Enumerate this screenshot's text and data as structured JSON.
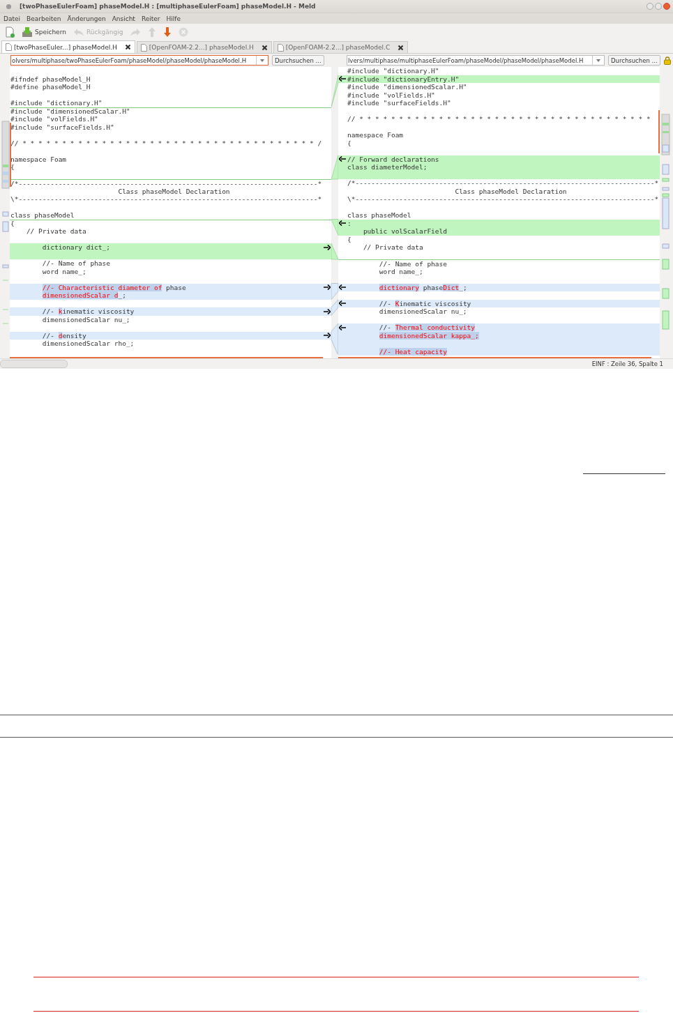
{
  "window": {
    "title": "[twoPhaseEulerFoam] phaseModel.H : [multiphaseEulerFoam] phaseModel.H - Meld"
  },
  "menu": [
    "Datei",
    "Bearbeiten",
    "Änderungen",
    "Ansicht",
    "Reiter",
    "Hilfe"
  ],
  "toolbar": [
    {
      "kind": "new",
      "disabled": false
    },
    {
      "kind": "save",
      "label": "Speichern",
      "disabled": false
    },
    {
      "kind": "undo",
      "label": "Rückgängig",
      "disabled": true
    },
    {
      "kind": "redo",
      "disabled": true
    },
    {
      "kind": "up",
      "disabled": true
    },
    {
      "kind": "down",
      "disabled": false
    },
    {
      "kind": "stop",
      "disabled": true
    }
  ],
  "tabs": [
    {
      "label": "[twoPhaseEuler...] phaseModel.H",
      "selected": true
    },
    {
      "label": "[OpenFOAM-2.2...] phaseModel.H",
      "selected": false
    },
    {
      "label": "[OpenFOAM-2.2...] phaseModel.C",
      "selected": false
    }
  ],
  "panes": [
    {
      "path": "olvers/multiphase/twoPhaseEulerFoam/phaseModel/phaseModel/phaseModel.H",
      "focused": true,
      "browse": "Durchsuchen ...",
      "lines": [
        {
          "kind": "plain"
        },
        {
          "kind": "plain",
          "text": "#ifndef phaseModel_H"
        },
        {
          "kind": "plain",
          "text": "#define phaseModel_H"
        },
        {
          "kind": "plain"
        },
        {
          "kind": "plain",
          "text": "#include \"dictionary.H\""
        },
        {
          "kind": "plain",
          "text": "#include \"dimensionedScalar.H\"",
          "mark": true
        },
        {
          "kind": "plain",
          "text": "#include \"volFields.H\""
        },
        {
          "kind": "plain",
          "text": "#include \"surfaceFields.H\""
        },
        {
          "kind": "plain"
        },
        {
          "kind": "plain",
          "text": "// * * * * * * * * * * * * * * * * * * * * * * * * * * * * * * * * * * * * * /"
        },
        {
          "kind": "plain"
        },
        {
          "kind": "plain",
          "text": "namespace Foam"
        },
        {
          "kind": "plain",
          "text": "{"
        },
        {
          "kind": "plain"
        },
        {
          "kind": "plain",
          "text": "/*---------------------------------------------------------------------------*",
          "mark": true
        },
        {
          "kind": "plain",
          "text": "                           Class phaseModel Declaration"
        },
        {
          "kind": "plain",
          "text": "\\*---------------------------------------------------------------------------*"
        },
        {
          "kind": "plain"
        },
        {
          "kind": "plain",
          "text": "class phaseModel"
        },
        {
          "kind": "plain",
          "text": "{",
          "mark": true
        },
        {
          "kind": "plain",
          "text": "    // Private data"
        },
        {
          "kind": "plain"
        },
        {
          "kind": "insert",
          "text": "        dictionary dict_;",
          "arrow": true
        },
        {
          "kind": "insert"
        },
        {
          "kind": "plain",
          "text": "        //- Name of phase"
        },
        {
          "kind": "plain",
          "text": "        word name_;"
        },
        {
          "kind": "plain"
        },
        {
          "kind": "change",
          "arrow": true,
          "segments": [
            {
              "t": "        //- Characteristic diameter of",
              "kind": "changed"
            },
            {
              "t": " phase",
              "kind": "plain"
            }
          ]
        },
        {
          "kind": "change",
          "segments": [
            {
              "t": "        dimensionedScalar d",
              "kind": "changed"
            },
            {
              "t": "_;",
              "kind": "plain"
            }
          ]
        },
        {
          "kind": "plain"
        },
        {
          "kind": "change",
          "arrow": true,
          "segments": [
            {
              "t": "        //- ",
              "kind": "plain"
            },
            {
              "t": "k",
              "kind": "changed"
            },
            {
              "t": "inematic viscosity",
              "kind": "plain"
            }
          ]
        },
        {
          "kind": "plain",
          "text": "        dimensionedScalar nu_;"
        },
        {
          "kind": "plain"
        },
        {
          "kind": "change",
          "arrow": true,
          "segments": [
            {
              "t": "        //- ",
              "kind": "plain"
            },
            {
              "t": "d",
              "kind": "changed"
            },
            {
              "t": "ensity",
              "kind": "plain"
            }
          ]
        },
        {
          "kind": "plain",
          "text": "        dimensionedScalar rho_;"
        }
      ]
    },
    {
      "path": "lvers/multiphase/multiphaseEulerFoam/phaseModel/phaseModel/phaseModel.H",
      "focused": false,
      "browse": "Durchsuchen ...",
      "lines": [
        {
          "kind": "plain",
          "text": "#include \"dictionary.H\""
        },
        {
          "kind": "insert",
          "text": "#include \"dictionaryEntry.H\"",
          "arrow": true
        },
        {
          "kind": "plain",
          "text": "#include \"dimensionedScalar.H\""
        },
        {
          "kind": "plain",
          "text": "#include \"volFields.H\""
        },
        {
          "kind": "plain",
          "text": "#include \"surfaceFields.H\""
        },
        {
          "kind": "plain"
        },
        {
          "kind": "plain",
          "text": "// * * * * * * * * * * * * * * * * * * * * * * * * * * * * * * * * * * * * *"
        },
        {
          "kind": "plain"
        },
        {
          "kind": "plain",
          "text": "namespace Foam"
        },
        {
          "kind": "plain",
          "text": "{"
        },
        {
          "kind": "plain"
        },
        {
          "kind": "insert",
          "text": "// Forward declarations",
          "arrow": true
        },
        {
          "kind": "insert",
          "text": "class diameterModel;"
        },
        {
          "kind": "insert"
        },
        {
          "kind": "plain",
          "text": "/*---------------------------------------------------------------------------*"
        },
        {
          "kind": "plain",
          "text": "                           Class phaseModel Declaration"
        },
        {
          "kind": "plain",
          "text": "\\*---------------------------------------------------------------------------*"
        },
        {
          "kind": "plain"
        },
        {
          "kind": "plain",
          "text": "class phaseModel"
        },
        {
          "kind": "insert",
          "text": ":",
          "arrow": true
        },
        {
          "kind": "insert",
          "text": "    public volScalarField"
        },
        {
          "kind": "plain",
          "text": "{"
        },
        {
          "kind": "plain",
          "text": "    // Private data"
        },
        {
          "kind": "plain"
        },
        {
          "kind": "plain",
          "text": "        //- Name of phase",
          "mark": true
        },
        {
          "kind": "plain",
          "text": "        word name_;"
        },
        {
          "kind": "plain"
        },
        {
          "kind": "change",
          "arrow": true,
          "segments": [
            {
              "t": "        dictionary",
              "kind": "changed"
            },
            {
              "t": " phase",
              "kind": "plain"
            },
            {
              "t": "Dict",
              "kind": "changed"
            },
            {
              "t": "_;",
              "kind": "plain"
            }
          ]
        },
        {
          "kind": "plain"
        },
        {
          "kind": "change",
          "arrow": true,
          "segments": [
            {
              "t": "        //- ",
              "kind": "plain"
            },
            {
              "t": "K",
              "kind": "changed"
            },
            {
              "t": "inematic viscosity",
              "kind": "plain"
            }
          ]
        },
        {
          "kind": "plain",
          "text": "        dimensionedScalar nu_;"
        },
        {
          "kind": "plain"
        },
        {
          "kind": "change",
          "arrow": true,
          "segments": [
            {
              "t": "        //- ",
              "kind": "plain"
            },
            {
              "t": "Thermal conductivity",
              "kind": "changed"
            }
          ]
        },
        {
          "kind": "change",
          "segments": [
            {
              "t": "        dimensionedScalar kappa_;",
              "kind": "changed"
            }
          ]
        },
        {
          "kind": "change"
        },
        {
          "kind": "change",
          "segments": [
            {
              "t": "        //- Heat capacity",
              "kind": "changed"
            }
          ]
        }
      ]
    }
  ],
  "status_bar": "EINF : Zeile 36, Spalte 1"
}
